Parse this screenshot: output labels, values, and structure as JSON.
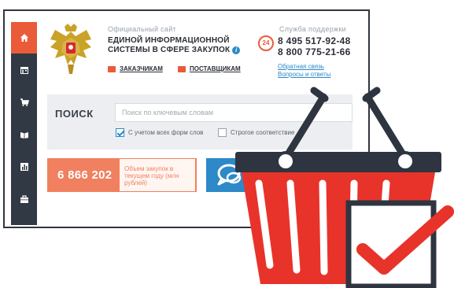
{
  "sidebar": {
    "items": [
      {
        "icon": "home-icon",
        "active": true
      },
      {
        "icon": "calendar-icon",
        "active": false
      },
      {
        "icon": "cart-icon",
        "active": false
      },
      {
        "icon": "book-icon",
        "active": false
      },
      {
        "icon": "chart-icon",
        "active": false
      },
      {
        "icon": "briefcase-icon",
        "active": false
      }
    ]
  },
  "header": {
    "site_label": "Официальный сайт",
    "title_line1": "ЕДИНОЙ ИНФОРМАЦИОННОЙ",
    "title_line2": "СИСТЕМЫ В СФЕРЕ ЗАКУПОК",
    "info_icon": "i",
    "customers_link": "ЗАКАЗЧИКАМ",
    "suppliers_link": "ПОСТАВЩИКАМ"
  },
  "support": {
    "label": "Служба поддержки",
    "hours": "24",
    "phone1": "8 495 517-92-48",
    "phone2": "8 800 775-21-66",
    "feedback_link": "Обратная связь",
    "faq_link": "Вопросы и ответы"
  },
  "search": {
    "label": "ПОИСК",
    "placeholder": "Поиск по ключевым словам",
    "option_wordforms": "С учетом всех форм слов",
    "option_wordforms_checked": true,
    "option_strict": "Строгое соответствие",
    "option_strict_checked": false
  },
  "stats": {
    "value": "6 866 202",
    "description": "Объем закупок в текущем году (млн рублей)"
  },
  "colors": {
    "accent": "#ea5b3a",
    "sidebar": "#313944",
    "link": "#2d89c8",
    "basket_red": "#e8332a",
    "basket_dark": "#2f3540"
  }
}
